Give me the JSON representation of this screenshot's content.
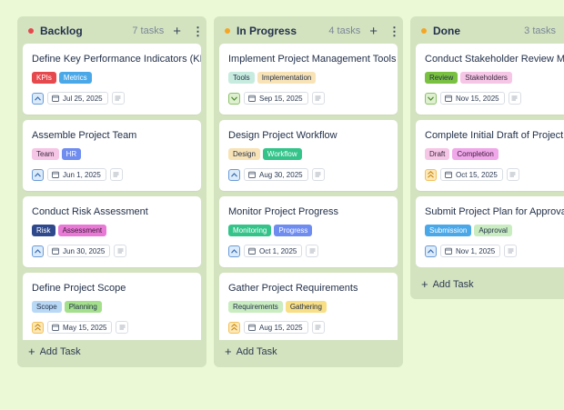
{
  "colors": {
    "board_background": "#ecf9d6",
    "column_background": "#d3e3c0",
    "backlog_dot": "#e5484d",
    "in_progress_dot": "#f5a524",
    "done_dot": "#f5a524"
  },
  "add_task_label": "Add Task",
  "columns": [
    {
      "title": "Backlog",
      "count": "7 tasks",
      "cards": [
        {
          "title": "Define Key Performance Indicators (KPIs)",
          "tags": [
            {
              "label": "KPIs",
              "bg": "#e5484d",
              "fg": "#ffffff"
            },
            {
              "label": "Metrics",
              "bg": "#4aa8e8",
              "fg": "#ffffff"
            }
          ],
          "priority": "up",
          "date": "Jul 25, 2025"
        },
        {
          "title": "Assemble Project Team",
          "tags": [
            {
              "label": "Team",
              "bg": "#f6c6e6",
              "fg": "#3a2a40"
            },
            {
              "label": "HR",
              "bg": "#6f8cf0",
              "fg": "#ffffff"
            }
          ],
          "priority": "up",
          "date": "Jun 1, 2025"
        },
        {
          "title": "Conduct Risk Assessment",
          "tags": [
            {
              "label": "Risk",
              "bg": "#2f4a8c",
              "fg": "#ffffff"
            },
            {
              "label": "Assessment",
              "bg": "#e87ad6",
              "fg": "#3a1a36"
            }
          ],
          "priority": "up",
          "date": "Jun 30, 2025"
        },
        {
          "title": "Define Project Scope",
          "tags": [
            {
              "label": "Scope",
              "bg": "#b9d8f5",
              "fg": "#23314a"
            },
            {
              "label": "Planning",
              "bg": "#a4e08c",
              "fg": "#23314a"
            }
          ],
          "priority": "high",
          "date": "May 15, 2025"
        }
      ]
    },
    {
      "title": "In Progress",
      "count": "4 tasks",
      "cards": [
        {
          "title": "Implement Project Management Tools",
          "tags": [
            {
              "label": "Tools",
              "bg": "#c7ecdf",
              "fg": "#23314a"
            },
            {
              "label": "Implementation",
              "bg": "#f8e3b7",
              "fg": "#23314a"
            }
          ],
          "priority": "down",
          "date": "Sep 15, 2025"
        },
        {
          "title": "Design Project Workflow",
          "tags": [
            {
              "label": "Design",
              "bg": "#f8e3b7",
              "fg": "#23314a"
            },
            {
              "label": "Workflow",
              "bg": "#34c48a",
              "fg": "#ffffff"
            }
          ],
          "priority": "up",
          "date": "Aug 30, 2025"
        },
        {
          "title": "Monitor Project Progress",
          "tags": [
            {
              "label": "Monitoring",
              "bg": "#34c48a",
              "fg": "#ffffff"
            },
            {
              "label": "Progress",
              "bg": "#6f8cf0",
              "fg": "#ffffff"
            }
          ],
          "priority": "up",
          "date": "Oct 1, 2025"
        },
        {
          "title": "Gather Project Requirements",
          "tags": [
            {
              "label": "Requirements",
              "bg": "#c9ecc0",
              "fg": "#23314a"
            },
            {
              "label": "Gathering",
              "bg": "#f8de84",
              "fg": "#23314a"
            }
          ],
          "priority": "high",
          "date": "Aug 15, 2025"
        }
      ]
    },
    {
      "title": "Done",
      "count": "3 tasks",
      "cards": [
        {
          "title": "Conduct Stakeholder Review Meeting",
          "tags": [
            {
              "label": "Review",
              "bg": "#7ac142",
              "fg": "#23314a"
            },
            {
              "label": "Stakeholders",
              "bg": "#f6c6e6",
              "fg": "#3a2a40"
            }
          ],
          "priority": "down",
          "date": "Nov 15, 2025"
        },
        {
          "title": "Complete Initial Draft of Project Plan",
          "tags": [
            {
              "label": "Draft",
              "bg": "#f6c6e6",
              "fg": "#3a2a40"
            },
            {
              "label": "Completion",
              "bg": "#f0a8ea",
              "fg": "#3a1a36"
            }
          ],
          "priority": "high",
          "date": "Oct 15, 2025"
        },
        {
          "title": "Submit Project Plan for Approval",
          "tags": [
            {
              "label": "Submission",
              "bg": "#4aa8e8",
              "fg": "#ffffff"
            },
            {
              "label": "Approval",
              "bg": "#c9ecc0",
              "fg": "#23314a"
            }
          ],
          "priority": "up",
          "date": "Nov 1, 2025"
        }
      ]
    }
  ]
}
